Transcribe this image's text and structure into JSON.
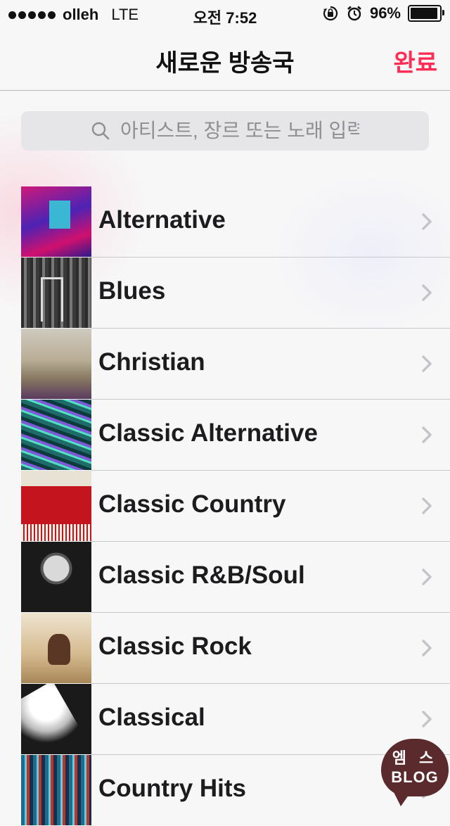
{
  "status_bar": {
    "carrier": "olleh",
    "network": "LTE",
    "time": "오전 7:52",
    "battery_percent": "96%",
    "battery_level": 0.96,
    "icons": [
      "signal-dots-icon",
      "rotation-lock-icon",
      "alarm-icon",
      "battery-icon"
    ]
  },
  "nav": {
    "title": "새로운 방송국",
    "done_label": "완료",
    "accent_color": "#ff2d55"
  },
  "search": {
    "placeholder": "아티스트, 장르 또는 노래 입력",
    "value": ""
  },
  "genres": [
    {
      "label": "Alternative",
      "thumb_icon": "alternative-artwork"
    },
    {
      "label": "Blues",
      "thumb_icon": "blues-artwork"
    },
    {
      "label": "Christian",
      "thumb_icon": "christian-artwork"
    },
    {
      "label": "Classic Alternative",
      "thumb_icon": "classic-alternative-artwork"
    },
    {
      "label": "Classic Country",
      "thumb_icon": "classic-country-artwork"
    },
    {
      "label": "Classic R&B/Soul",
      "thumb_icon": "classic-rnb-soul-artwork"
    },
    {
      "label": "Classic Rock",
      "thumb_icon": "classic-rock-artwork"
    },
    {
      "label": "Classical",
      "thumb_icon": "classical-artwork"
    },
    {
      "label": "Country Hits",
      "thumb_icon": "country-hits-artwork"
    }
  ],
  "watermark": {
    "top": "엠 스",
    "bottom": "BLOG"
  }
}
